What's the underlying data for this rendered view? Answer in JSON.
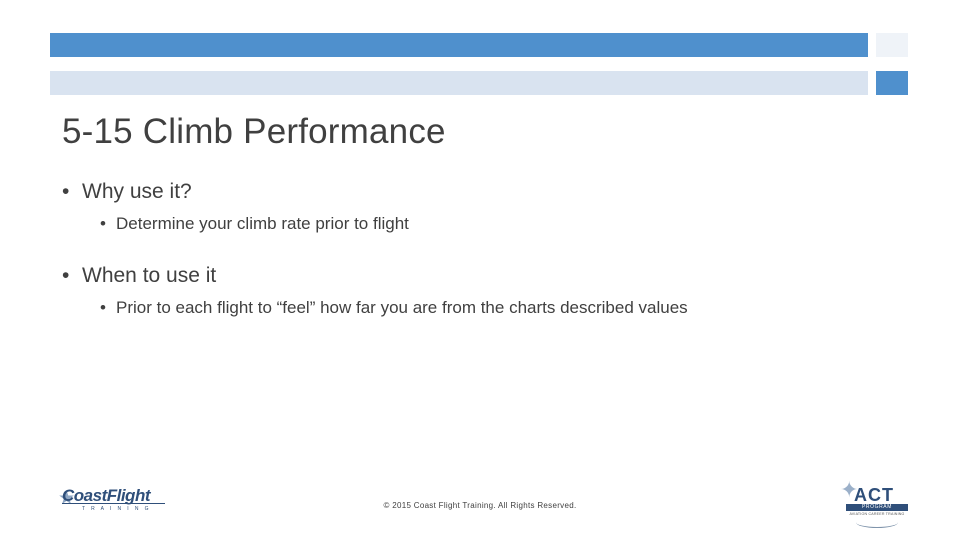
{
  "slide": {
    "title": "5-15 Climb Performance",
    "bullets": [
      {
        "level": 1,
        "marker": "•",
        "text": "Why use it?"
      },
      {
        "level": 2,
        "marker": "•",
        "text": "Determine your climb rate prior to flight"
      },
      {
        "level": 1,
        "marker": "•",
        "text": "When to use it"
      },
      {
        "level": 2,
        "marker": "•",
        "text": "Prior to each flight to “feel” how far you are from the charts described values"
      }
    ]
  },
  "footer": {
    "copyright": "© 2015 Coast Flight Training. All Rights Reserved."
  },
  "logos": {
    "left": {
      "name": "CoastFlight",
      "subtitle": "T R A I N I N G",
      "star_glyph": "★"
    },
    "right": {
      "name": "ACT",
      "band": "PROGRAM",
      "subtitle": "AVIATION CAREER TRAINING",
      "star_glyph": "✦"
    }
  },
  "colors": {
    "accent_blue": "#4f90cd",
    "light_blue": "#d9e3f0",
    "pale": "#eff3f8",
    "text": "#404040",
    "logo_navy": "#2f4f7a"
  }
}
